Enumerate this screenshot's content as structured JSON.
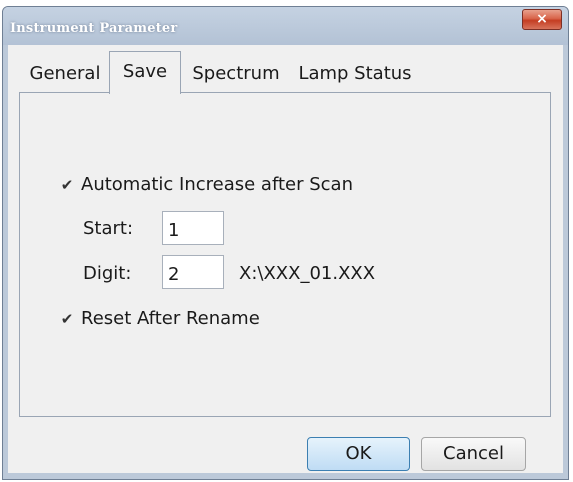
{
  "window": {
    "title": "Instrument Parameter",
    "close_glyph": "×"
  },
  "tabs": [
    {
      "label": "General",
      "active": false
    },
    {
      "label": "Save",
      "active": true
    },
    {
      "label": "Spectrum",
      "active": false
    },
    {
      "label": "Lamp Status",
      "active": false
    }
  ],
  "save_panel": {
    "auto_increase": {
      "label": "Automatic Increase after Scan",
      "checked": true,
      "glyph": "✔"
    },
    "start": {
      "label": "Start:",
      "value": "1"
    },
    "digit": {
      "label": "Digit:",
      "value": "2"
    },
    "filename_preview": "X:\\XXX_01.XXX",
    "reset_after_rename": {
      "label": "Reset After Rename",
      "checked": true,
      "glyph": "✔"
    }
  },
  "buttons": {
    "ok": "OK",
    "cancel": "Cancel"
  },
  "colors": {
    "title_bar": "#bcc9d9",
    "close_button": "#c43d22",
    "ok_button": "#bfdcf4",
    "dialog_bg": "#f0f0f0"
  }
}
